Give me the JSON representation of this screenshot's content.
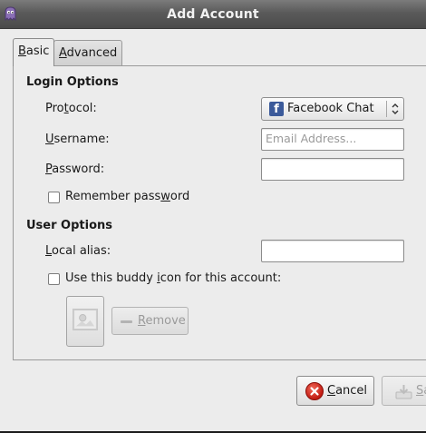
{
  "window": {
    "title": "Add Account"
  },
  "tabs": [
    {
      "label": "Basic",
      "mnemonic": "B",
      "rest": "asic"
    },
    {
      "label": "Advanced",
      "mnemonic": "A",
      "rest": "dvanced"
    }
  ],
  "login_options": {
    "heading": "Login Options",
    "protocol": {
      "label_pre": "Pro",
      "mnemonic": "t",
      "label_post": "ocol:",
      "value": "Facebook Chat"
    },
    "username": {
      "mnemonic": "U",
      "label_post": "sername:",
      "placeholder": "Email Address...",
      "value": ""
    },
    "password": {
      "mnemonic": "P",
      "label_post": "assword:",
      "value": ""
    },
    "remember": {
      "label_pre": "Remember pass",
      "mnemonic": "w",
      "label_post": "ord",
      "checked": false
    }
  },
  "user_options": {
    "heading": "User Options",
    "alias": {
      "mnemonic": "L",
      "label_post": "ocal alias:",
      "value": ""
    },
    "buddy_icon": {
      "label_pre": "Use this buddy ",
      "mnemonic": "i",
      "label_post": "con for this account:",
      "checked": false
    },
    "remove": {
      "mnemonic": "R",
      "label_post": "emove"
    }
  },
  "actions": {
    "cancel": {
      "mnemonic": "C",
      "label_post": "ancel"
    },
    "save": {
      "mnemonic": "S",
      "label_post": "a"
    }
  },
  "colors": {
    "facebook": "#3b5a9a",
    "cancel_red": "#c21b12",
    "titlebar": "#5a5a5a"
  }
}
